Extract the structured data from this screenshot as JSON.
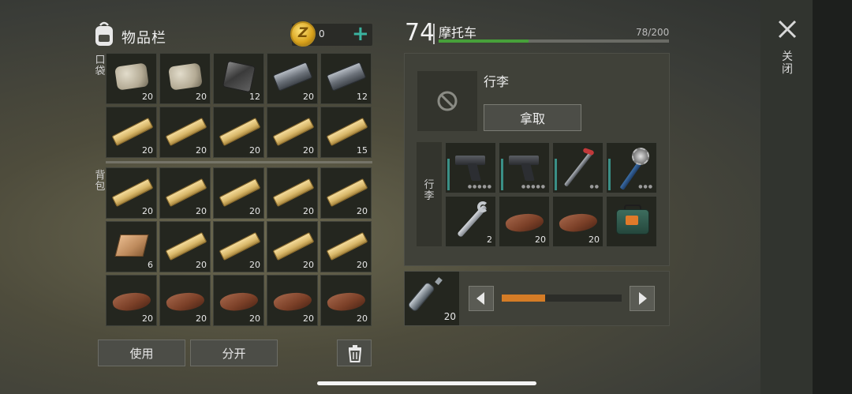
{
  "inventory": {
    "title": "物品栏",
    "coins": "0",
    "pocket_label": "口袋",
    "backpack_label": "背包",
    "pocket_slots": [
      {
        "item": "stone",
        "count": "20"
      },
      {
        "item": "stone",
        "count": "20"
      },
      {
        "item": "metal",
        "count": "12"
      },
      {
        "item": "ingot",
        "count": "20"
      },
      {
        "item": "ingot",
        "count": "12"
      },
      {
        "item": "plank",
        "count": "20"
      },
      {
        "item": "plank",
        "count": "20"
      },
      {
        "item": "plank",
        "count": "20"
      },
      {
        "item": "plank",
        "count": "20"
      },
      {
        "item": "plank",
        "count": "15"
      }
    ],
    "backpack_slots": [
      {
        "item": "plank",
        "count": "20"
      },
      {
        "item": "plank",
        "count": "20"
      },
      {
        "item": "plank",
        "count": "20"
      },
      {
        "item": "plank",
        "count": "20"
      },
      {
        "item": "plank",
        "count": "20"
      },
      {
        "item": "log",
        "count": "6"
      },
      {
        "item": "plank",
        "count": "20"
      },
      {
        "item": "plank",
        "count": "20"
      },
      {
        "item": "plank",
        "count": "20"
      },
      {
        "item": "plank",
        "count": "20"
      },
      {
        "item": "leather",
        "count": "20"
      },
      {
        "item": "leather",
        "count": "20"
      },
      {
        "item": "leather",
        "count": "20"
      },
      {
        "item": "leather",
        "count": "20"
      },
      {
        "item": "leather",
        "count": "20"
      }
    ],
    "use_label": "使用",
    "split_label": "分开"
  },
  "vehicle": {
    "level": "74",
    "name": "摩托车",
    "capacity": "78/200",
    "capacity_fraction": 0.39,
    "luggage_title": "行李",
    "take_label": "拿取",
    "luggage_side_label": "行李",
    "slots": [
      {
        "item": "pistol",
        "count": ""
      },
      {
        "item": "pistol",
        "count": ""
      },
      {
        "item": "crowbar",
        "count": ""
      },
      {
        "item": "mace",
        "count": ""
      },
      {
        "item": "wrench",
        "count": "2"
      },
      {
        "item": "leather",
        "count": "20"
      },
      {
        "item": "leather",
        "count": "20"
      },
      {
        "item": "kit",
        "count": ""
      }
    ],
    "fuel_count": "20",
    "fuel_fraction": 0.36
  },
  "close_label": "关闭",
  "colors": {
    "accent": "#3bb3a0",
    "capacity_bar": "#47a03a",
    "fuel_bar": "#d57c26"
  }
}
